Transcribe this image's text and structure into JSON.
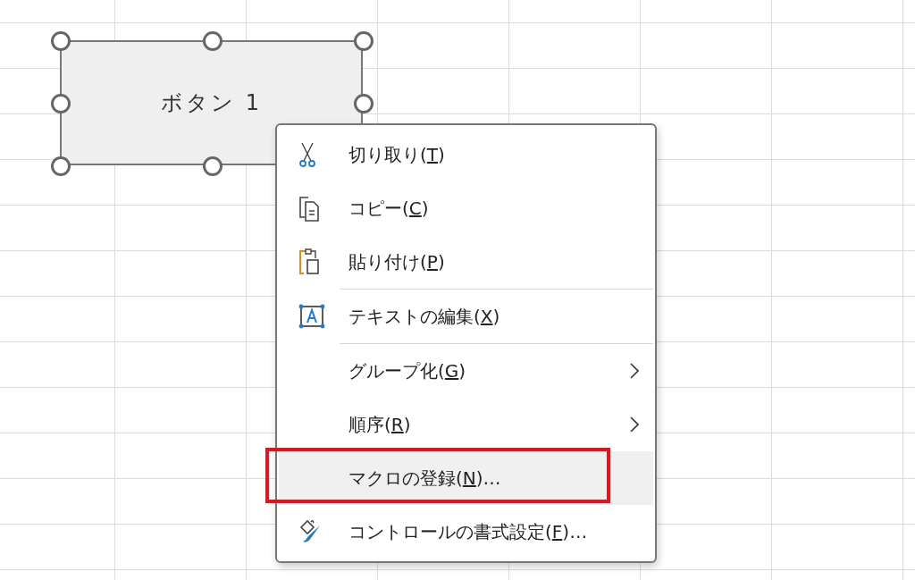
{
  "shape": {
    "label": "ボタン 1",
    "selected": true
  },
  "context_menu": {
    "items": [
      {
        "kind": "command",
        "before": "切り取り(",
        "access_key": "T",
        "after": ")",
        "separator_after": false,
        "selected": false,
        "annotated": false
      },
      {
        "kind": "command",
        "before": "コピー(",
        "access_key": "C",
        "after": ")",
        "separator_after": false,
        "selected": false,
        "annotated": false
      },
      {
        "kind": "command",
        "before": "貼り付け(",
        "access_key": "P",
        "after": ")",
        "separator_after": true,
        "selected": false,
        "annotated": false
      },
      {
        "kind": "command",
        "before": "テキストの編集(",
        "access_key": "X",
        "after": ")",
        "separator_after": true,
        "selected": false,
        "annotated": false
      },
      {
        "kind": "submenu",
        "before": "グループ化(",
        "access_key": "G",
        "after": ")",
        "separator_after": false,
        "selected": false,
        "annotated": false
      },
      {
        "kind": "submenu",
        "before": "順序(",
        "access_key": "R",
        "after": ")",
        "separator_after": false,
        "selected": false,
        "annotated": false
      },
      {
        "kind": "command",
        "before": "マクロの登録(",
        "access_key": "N",
        "after": ")…",
        "separator_after": false,
        "selected": true,
        "annotated": true
      },
      {
        "kind": "command",
        "before": "コントロールの書式設定(",
        "access_key": "F",
        "after": ")…",
        "separator_after": false,
        "selected": false,
        "annotated": false
      }
    ]
  }
}
